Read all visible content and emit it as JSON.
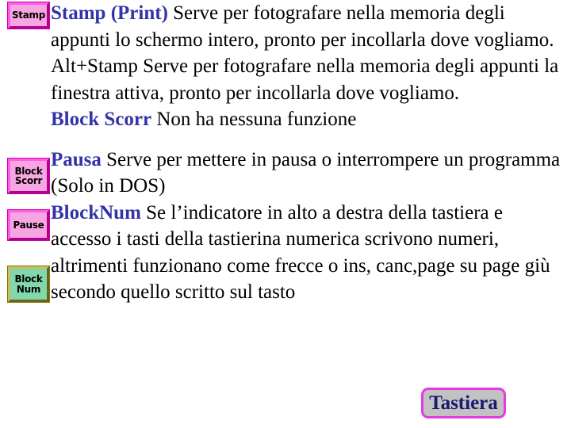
{
  "slide": {
    "keys": [
      {
        "id": "stamp",
        "name": "key-stamp",
        "lines": [
          "Stamp"
        ],
        "color_scheme": "pink",
        "fill": "#f7a6e2",
        "border": "#cc00a8"
      },
      {
        "id": "blockscorr",
        "name": "key-block-scorr",
        "lines": [
          "Block",
          "Scorr"
        ],
        "color_scheme": "pink",
        "fill": "#f7a6e2",
        "border": "#cc00a8"
      },
      {
        "id": "pausa",
        "name": "key-pause",
        "lines": [
          "Pause"
        ],
        "color_scheme": "pink",
        "fill": "#f7a6e2",
        "border": "#cc00a8"
      },
      {
        "id": "blocknum",
        "name": "key-block-num",
        "lines": [
          "Block",
          "Num"
        ],
        "color_scheme": "green",
        "fill": "#82d7ad",
        "border": "#7d7519"
      }
    ],
    "paragraphs": [
      {
        "id": "stamp-print",
        "lead": "Stamp (Print)",
        "body": " Serve per fotografare nella memoria degli appunti lo schermo intero, pronto per incollarla dove vogliamo."
      },
      {
        "id": "alt-stamp",
        "lead": "",
        "body": "Alt+Stamp Serve per fotografare nella memoria degli appunti la finestra attiva, pronto per incollarla dove vogliamo."
      },
      {
        "id": "block-scorr",
        "lead": "Block Scorr",
        "body": " Non ha nessuna funzione"
      },
      {
        "id": "pausa",
        "lead": "Pausa",
        "body": " Serve per mettere in pausa o interrompere un programma (Solo in DOS)"
      },
      {
        "id": "block-num",
        "lead": "BlockNum",
        "body": " Se l’indicatore in alto a destra della tastiera e accesso i tasti della tastierina numerica scrivono numeri, altrimenti funzionano come frecce o ins, canc,page su page giù secondo quello scritto sul tasto"
      }
    ],
    "callout": {
      "label": "Tastiera",
      "fill": "#c2c2c2",
      "border": "#e23ce2",
      "text_color": "#191970"
    },
    "lead_color": "#3333a8"
  }
}
